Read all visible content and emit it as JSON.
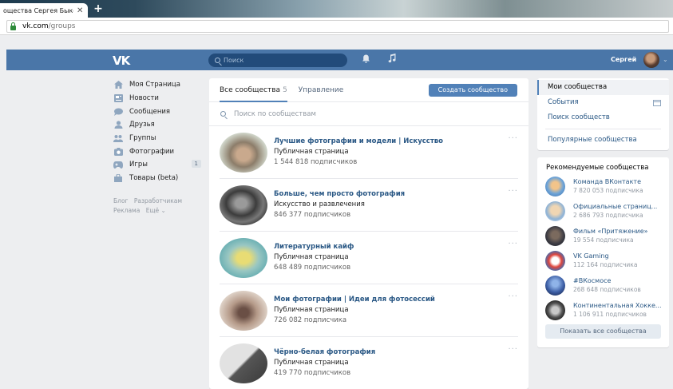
{
  "browser": {
    "tab_title": "ощества Сергея Быкс",
    "tab_close": "✕",
    "new_tab": "+",
    "url_host": "vk.com",
    "url_path": "/groups"
  },
  "header": {
    "logo": "VK",
    "search_placeholder": "Поиск",
    "user_name": "Сергей",
    "accent_color": "#4a76a8"
  },
  "left_nav": {
    "items": [
      {
        "label": "Моя Страница",
        "icon": "home-icon"
      },
      {
        "label": "Новости",
        "icon": "news-icon"
      },
      {
        "label": "Сообщения",
        "icon": "messages-icon"
      },
      {
        "label": "Друзья",
        "icon": "friends-icon"
      },
      {
        "label": "Группы",
        "icon": "groups-icon"
      },
      {
        "label": "Фотографии",
        "icon": "photos-icon"
      },
      {
        "label": "Игры",
        "icon": "games-icon",
        "badge": "1"
      },
      {
        "label": "Товары (beta)",
        "icon": "goods-icon"
      }
    ],
    "footer_line1": [
      "Блог",
      "Разработчикам"
    ],
    "footer_line2": [
      "Реклама",
      "Ещё ⌄"
    ]
  },
  "main": {
    "tab_all_label": "Все сообщества",
    "tab_all_count": "5",
    "tab_manage_label": "Управление",
    "create_button": "Создать сообщество",
    "search_placeholder": "Поиск по сообществам",
    "more": "···",
    "groups": [
      {
        "name": "Лучшие фотографии и модели | Искусство",
        "type": "Публичная страница",
        "subs": "1 544 818 подписчиков"
      },
      {
        "name": "Больше, чем просто фотография",
        "type": "Искусство и развлечения",
        "subs": "846 377 подписчиков"
      },
      {
        "name": "Литературный кайф",
        "type": "Публичная страница",
        "subs": "648 489 подписчиков"
      },
      {
        "name": "Мои фотографии | Идеи для фотосессий",
        "type": "Публичная страница",
        "subs": "726 082 подписчика"
      },
      {
        "name": "Чёрно-белая фотография",
        "type": "Публичная страница",
        "subs": "419 770 подписчиков"
      }
    ]
  },
  "right_menu": {
    "items": [
      "Мои сообщества",
      "События",
      "Поиск сообществ"
    ],
    "popular": "Популярные сообщества"
  },
  "recommended": {
    "title": "Рекомендуемые сообщества",
    "items": [
      {
        "name": "Команда ВКонтакте",
        "subs": "7 820 053 подписчика"
      },
      {
        "name": "Официальные страниц...",
        "subs": "2 686 793 подписчика"
      },
      {
        "name": "Фильм «Притяжение»",
        "subs": "19 554 подписчика"
      },
      {
        "name": "VK Gaming",
        "subs": "112 164 подписчика"
      },
      {
        "name": "#ВКосмосе",
        "subs": "268 648 подписчиков"
      },
      {
        "name": "Континентальная Хокке...",
        "subs": "1 106 911 подписчиков"
      }
    ],
    "show_all": "Показать все сообщества"
  }
}
